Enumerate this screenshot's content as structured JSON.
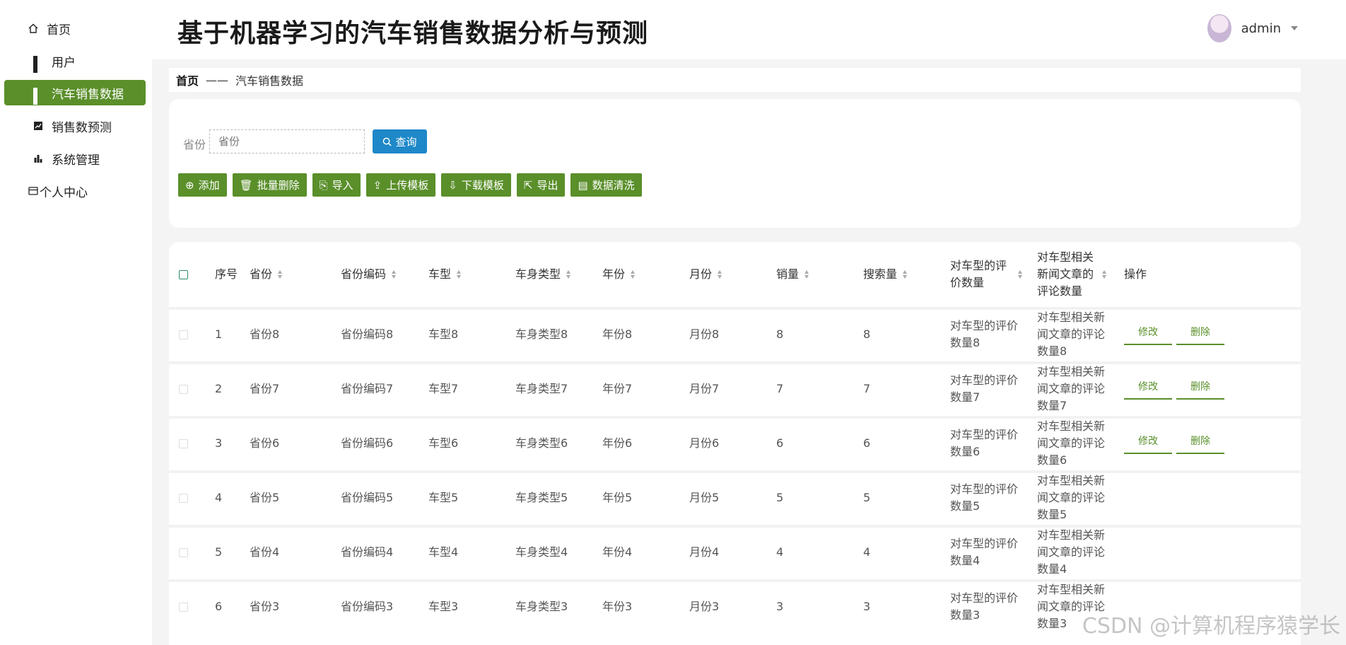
{
  "sidebar": {
    "items": [
      {
        "label": "首页",
        "icon": "home-icon"
      },
      {
        "label": "用户",
        "icon": "grid-icon"
      },
      {
        "label": "汽车销售数据",
        "icon": "grid-icon"
      },
      {
        "label": "销售数预测",
        "icon": "line-chart-icon"
      },
      {
        "label": "系统管理",
        "icon": "bar-chart-icon"
      },
      {
        "label": "个人中心",
        "icon": "card-icon"
      }
    ]
  },
  "header": {
    "title": "基于机器学习的汽车销售数据分析与预测",
    "user": "admin"
  },
  "breadcrumb": {
    "home": "首页",
    "sep": "——",
    "current": "汽车销售数据"
  },
  "search": {
    "label": "省份",
    "placeholder": "省份",
    "query_label": "查询"
  },
  "actions": [
    "添加",
    "批量删除",
    "导入",
    "上传模板",
    "下载模板",
    "导出",
    "数据清洗"
  ],
  "table": {
    "headers": [
      "序号",
      "省份",
      "省份编码",
      "车型",
      "车身类型",
      "年份",
      "月份",
      "销量",
      "搜索量",
      "对车型的评价数量",
      "对车型相关新闻文章的评论数量",
      "操作"
    ],
    "edit_label": "修改",
    "delete_label": "删除",
    "rows": [
      [
        "1",
        "省份8",
        "省份编码8",
        "车型8",
        "车身类型8",
        "年份8",
        "月份8",
        "8",
        "8",
        "对车型的评价数量8",
        "对车型相关新闻文章的评论数量8"
      ],
      [
        "2",
        "省份7",
        "省份编码7",
        "车型7",
        "车身类型7",
        "年份7",
        "月份7",
        "7",
        "7",
        "对车型的评价数量7",
        "对车型相关新闻文章的评论数量7"
      ],
      [
        "3",
        "省份6",
        "省份编码6",
        "车型6",
        "车身类型6",
        "年份6",
        "月份6",
        "6",
        "6",
        "对车型的评价数量6",
        "对车型相关新闻文章的评论数量6"
      ],
      [
        "4",
        "省份5",
        "省份编码5",
        "车型5",
        "车身类型5",
        "年份5",
        "月份5",
        "5",
        "5",
        "对车型的评价数量5",
        "对车型相关新闻文章的评论数量5"
      ],
      [
        "5",
        "省份4",
        "省份编码4",
        "车型4",
        "车身类型4",
        "年份4",
        "月份4",
        "4",
        "4",
        "对车型的评价数量4",
        "对车型相关新闻文章的评论数量4"
      ],
      [
        "6",
        "省份3",
        "省份编码3",
        "车型3",
        "车身类型3",
        "年份3",
        "月份3",
        "3",
        "3",
        "对车型的评价数量3",
        "对车型相关新闻文章的评论数量3"
      ]
    ]
  },
  "watermark": "CSDN @计算机程序猿学长",
  "colors": {
    "primary": "#5a8f2a",
    "query": "#1e88c8"
  }
}
